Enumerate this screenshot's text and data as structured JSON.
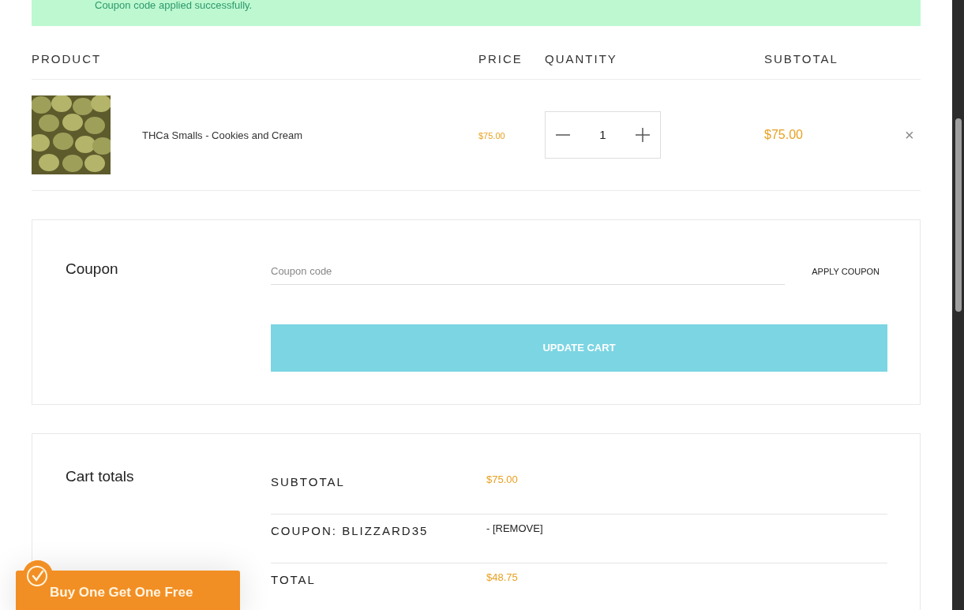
{
  "notice": {
    "text": "Coupon code applied successfully."
  },
  "table": {
    "columns": [
      "PRODUCT",
      "PRICE",
      "QUANTITY",
      "SUBTOTAL"
    ],
    "rows": [
      {
        "kind": "picture",
        "name": "THCa Smalls - Cookies and Cream",
        "price": "$75.00",
        "quantity": "1",
        "subtotal": "$75.00",
        "remove": "×"
      }
    ]
  },
  "coupon": {
    "title": "Coupon",
    "placeholder": "Coupon code",
    "apply": "APPLY COUPON",
    "update": "UPDATE CART"
  },
  "totals": {
    "title": "Cart totals",
    "rows": [
      {
        "kind": "amount",
        "label": "SUBTOTAL",
        "value": "$75.00"
      },
      {
        "kind": "link",
        "label": "COUPON: BLIZZARD35",
        "value": "- [REMOVE]"
      },
      {
        "kind": "amount",
        "label": "TOTAL",
        "value": "$48.75"
      }
    ]
  },
  "promo": {
    "text": "Buy One Get One Free"
  }
}
